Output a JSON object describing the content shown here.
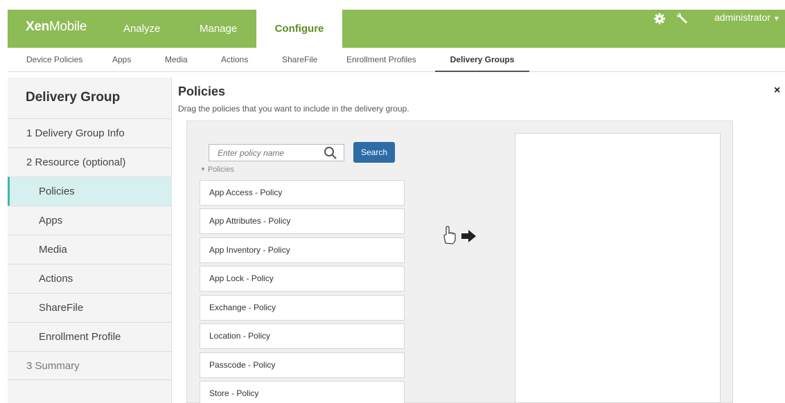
{
  "header": {
    "logo_bold": "Xen",
    "logo_light": "Mobile",
    "nav": [
      {
        "label": "Analyze"
      },
      {
        "label": "Manage"
      },
      {
        "label": "Configure"
      }
    ],
    "user": "administrator"
  },
  "subnav": [
    {
      "label": "Device Policies"
    },
    {
      "label": "Apps"
    },
    {
      "label": "Media"
    },
    {
      "label": "Actions"
    },
    {
      "label": "ShareFile"
    },
    {
      "label": "Enrollment Profiles"
    },
    {
      "label": "Delivery Groups"
    }
  ],
  "sidebar": {
    "title": "Delivery Group",
    "items": [
      {
        "label": "1  Delivery Group Info"
      },
      {
        "label": "2  Resource (optional)"
      },
      {
        "label": "Policies"
      },
      {
        "label": "Apps"
      },
      {
        "label": "Media"
      },
      {
        "label": "Actions"
      },
      {
        "label": "ShareFile"
      },
      {
        "label": "Enrollment Profile"
      },
      {
        "label": "3  Summary"
      }
    ]
  },
  "main": {
    "title": "Policies",
    "subtitle": "Drag the policies that you want to include in the delivery group.",
    "close": "×",
    "search": {
      "placeholder": "Enter policy name",
      "button": "Search"
    },
    "list_label": "Policies",
    "policies": [
      {
        "label": "App Access - Policy"
      },
      {
        "label": "App Attributes - Policy"
      },
      {
        "label": "App Inventory - Policy"
      },
      {
        "label": "App Lock - Policy"
      },
      {
        "label": "Exchange - Policy"
      },
      {
        "label": "Location - Policy"
      },
      {
        "label": "Passcode - Policy"
      },
      {
        "label": "Store - Policy"
      }
    ]
  },
  "colors": {
    "topbar": "#8dbb55",
    "accent_teal": "#3bb6ae",
    "search_button": "#2d6ca6"
  }
}
